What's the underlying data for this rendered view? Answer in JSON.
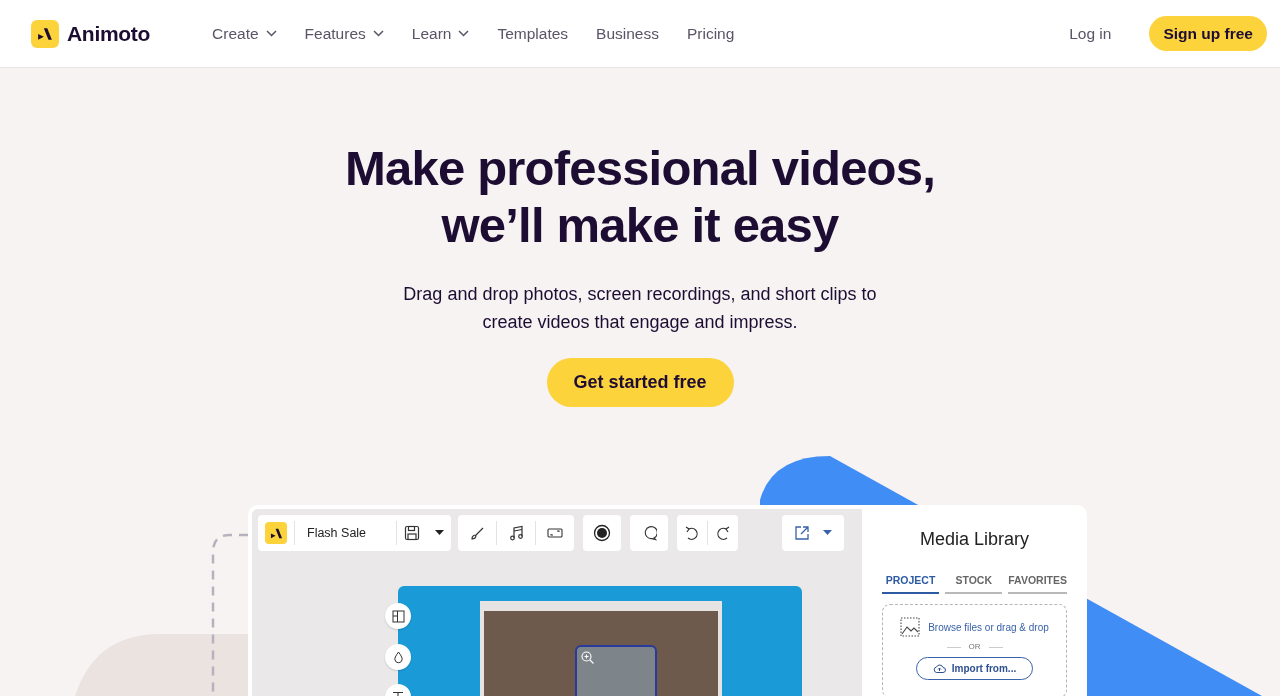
{
  "nav": {
    "logo": "Animoto",
    "items": [
      {
        "label": "Create",
        "dropdown": true
      },
      {
        "label": "Features",
        "dropdown": true
      },
      {
        "label": "Learn",
        "dropdown": true
      },
      {
        "label": "Templates",
        "dropdown": false
      },
      {
        "label": "Business",
        "dropdown": false
      },
      {
        "label": "Pricing",
        "dropdown": false
      }
    ],
    "login": "Log in",
    "signup": "Sign up free"
  },
  "hero": {
    "title_lines": [
      "Make professional videos,",
      "we’ll make it easy"
    ],
    "subtitle_lines": [
      "Drag and drop photos, screen recordings, and short clips to",
      "create videos that engage and impress."
    ],
    "cta": "Get started free"
  },
  "editor": {
    "project_name": "Flash Sale",
    "media_library": {
      "title": "Media Library",
      "tabs": [
        {
          "label": "PROJECT",
          "selected": true
        },
        {
          "label": "STOCK",
          "selected": false
        },
        {
          "label": "FAVORITES",
          "selected": false
        }
      ],
      "browse": "Browse files or drag & drop",
      "or": "OR",
      "import": "Import from..."
    }
  }
}
